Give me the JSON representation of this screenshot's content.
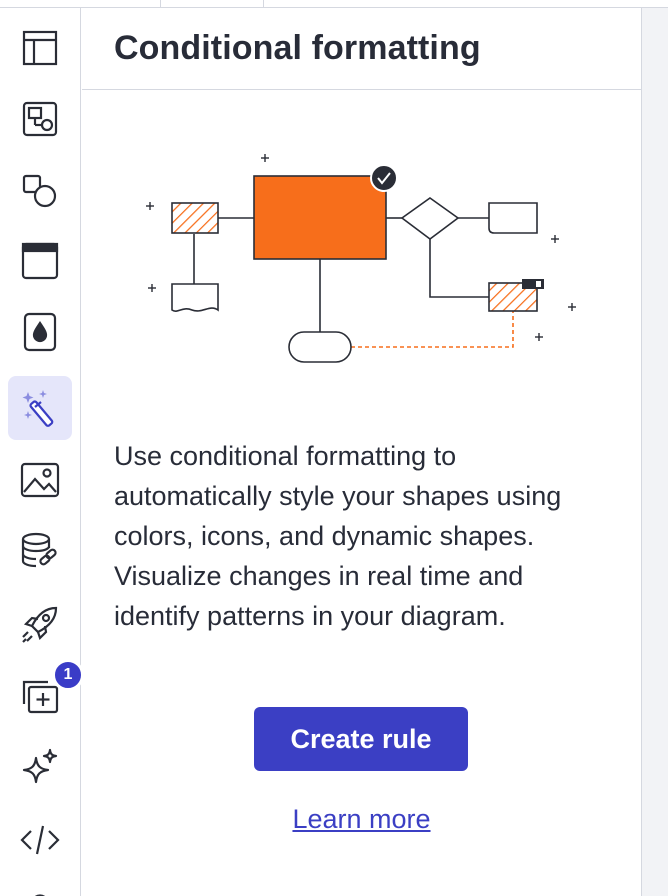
{
  "panel": {
    "title": "Conditional formatting",
    "description": "Use conditional formatting to automatically style your shapes using colors, icons, and dynamic shapes. Visualize changes in real time and identify patterns in your diagram.",
    "create_button_label": "Create rule",
    "learn_more_label": "Learn more"
  },
  "rail": {
    "items": [
      {
        "icon": "layout-panel-icon"
      },
      {
        "icon": "shapes-library-icon"
      },
      {
        "icon": "shapes-icon"
      },
      {
        "icon": "window-frame-icon"
      },
      {
        "icon": "fill-drop-icon"
      },
      {
        "icon": "magic-wand-icon",
        "active": true
      },
      {
        "icon": "image-icon"
      },
      {
        "icon": "data-link-icon"
      },
      {
        "icon": "rocket-icon"
      },
      {
        "icon": "add-frame-icon"
      },
      {
        "icon": "sparkle-icon"
      },
      {
        "icon": "code-icon"
      }
    ],
    "notification_count": "1"
  },
  "colors": {
    "accent": "#3b3fc4",
    "active_bg": "#e5e6fa",
    "shape_orange": "#f76e1b"
  }
}
